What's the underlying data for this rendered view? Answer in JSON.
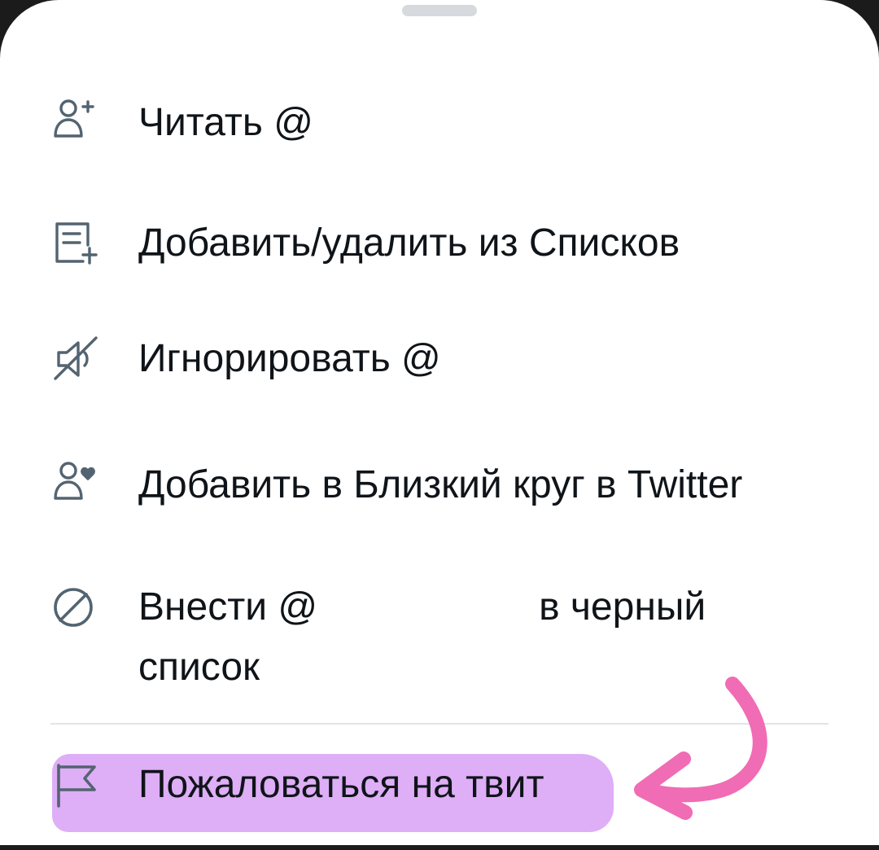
{
  "menu": {
    "items": [
      {
        "label": "Читать @",
        "icon": "follow-icon"
      },
      {
        "label": "Добавить/удалить из Списков",
        "icon": "list-add-icon"
      },
      {
        "label": "Игнорировать @",
        "icon": "mute-icon"
      },
      {
        "label": "Добавить в Близкий круг в Twitter",
        "icon": "close-circle-icon"
      },
      {
        "label_line1_a": "Внести @",
        "label_line1_b": "в черный",
        "label_line2": "список",
        "icon": "block-icon"
      },
      {
        "label": "Пожаловаться на твит",
        "icon": "flag-icon"
      }
    ]
  },
  "colors": {
    "text": "#0f1419",
    "icon": "#536471",
    "highlight": "#dcaaf5",
    "arrow": "#f06cb4",
    "divider": "#e1e4e8"
  }
}
